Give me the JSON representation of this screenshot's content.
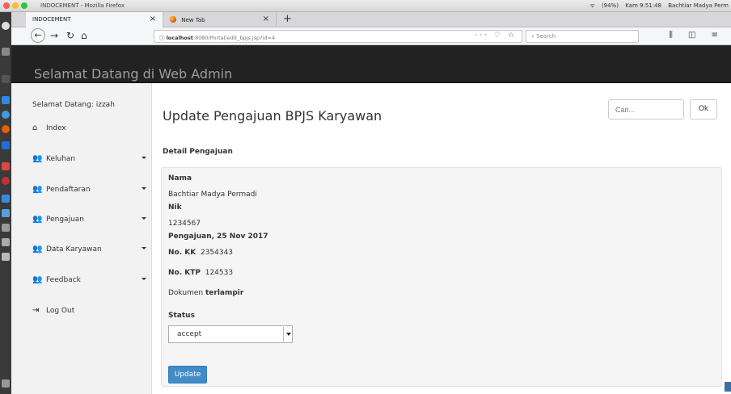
{
  "window": {
    "title": "INDOCEMENT - Mozilla Firefox"
  },
  "system": {
    "battery": "(94%)",
    "clock": "Kam 9:51:48",
    "user": "Bachtiar Madya Perm"
  },
  "tabs": [
    {
      "label": "INDOCEMENT",
      "close": "×"
    },
    {
      "label": "New Tab",
      "close": "×"
    }
  ],
  "newtab": "+",
  "nav": {
    "host": "localhost",
    "path": ":8080/Portal/edit_bpjs.jsp?id=4",
    "search_placeholder": "Search",
    "url_icons": "··· ♡ ☆",
    "right_icons": "⫼ ◫ ≡"
  },
  "site": {
    "brand": "Selamat Datang di Web Admin"
  },
  "sidebar": {
    "welcome": "Selamat Datang: izzah",
    "items": [
      {
        "label": "Index",
        "icon": "home-icon"
      },
      {
        "label": "Keluhan",
        "icon": "users-icon"
      },
      {
        "label": "Pendaftaran",
        "icon": "users-icon"
      },
      {
        "label": "Pengajuan",
        "icon": "users-icon"
      },
      {
        "label": "Data Karyawan",
        "icon": "users-icon"
      },
      {
        "label": "Feedback",
        "icon": "users-icon"
      },
      {
        "label": "Log Out",
        "icon": "logout-icon"
      }
    ]
  },
  "main": {
    "title": "Update Pengajuan BPJS Karyawan",
    "search_placeholder": "Cari...",
    "ok_label": "Ok",
    "section": "Detail Pengajuan",
    "nama_label": "Nama",
    "nama_value": "Bachtiar Madya Permadi",
    "nik_label": "Nik",
    "nik_value": "1234567",
    "pengajuan_label": "Pengajuan, 25 Nov 2017",
    "kk_label": "No. KK",
    "kk_value": "2354343",
    "ktp_label": "No. KTP",
    "ktp_value": "124533",
    "dokumen_prefix": "Dokumen",
    "dokumen_status": "terlampir",
    "status_label": "Status",
    "status_value": "accept",
    "update_label": "Update"
  }
}
